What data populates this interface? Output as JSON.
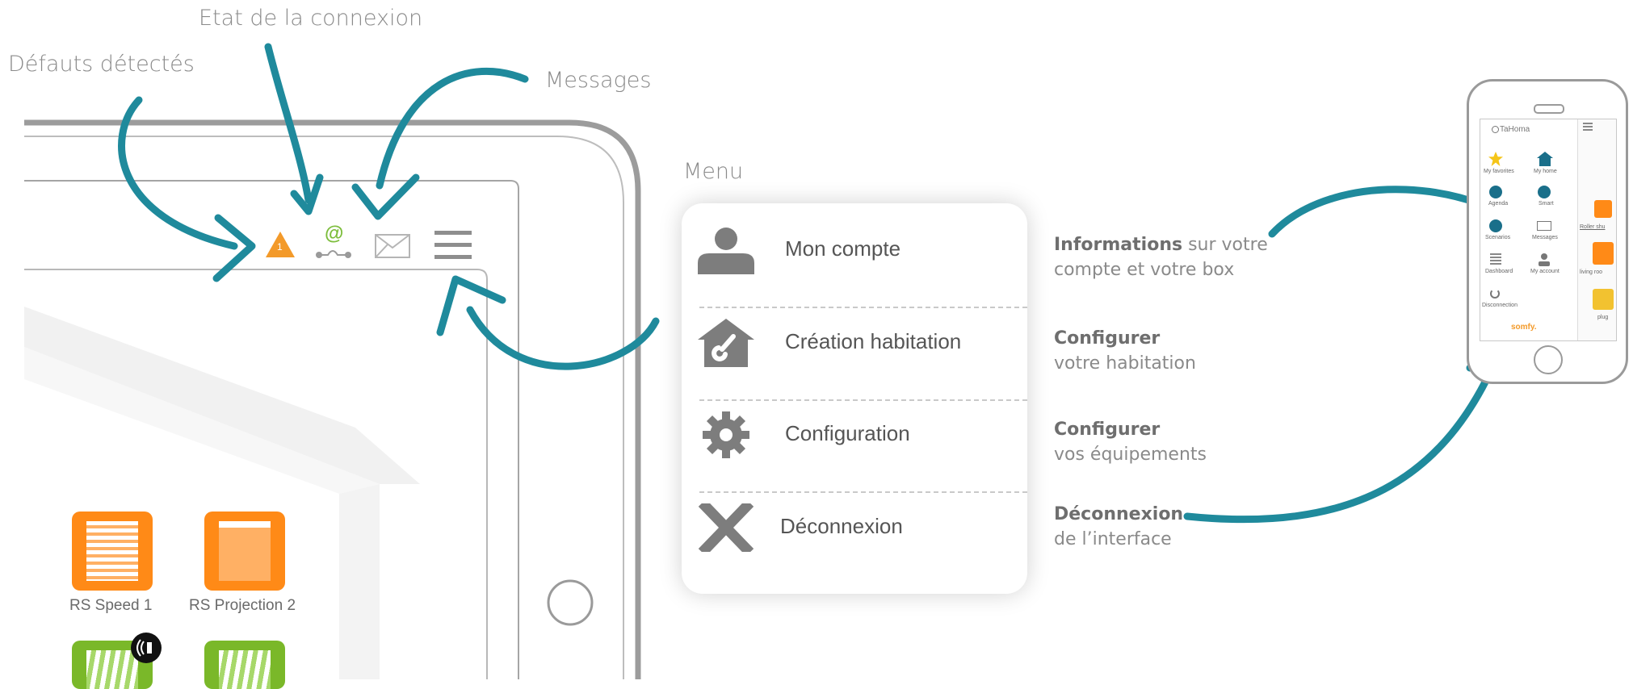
{
  "annotations": {
    "faults": "Défauts détectés",
    "connection": "Etat de la connexion",
    "messages": "Messages",
    "menu": "Menu"
  },
  "toolbar": {
    "alert_count": "1",
    "at_symbol": "@"
  },
  "menu": {
    "items": [
      {
        "label": "Mon compte"
      },
      {
        "label": "Création habitation"
      },
      {
        "label": "Configuration"
      },
      {
        "label": "Déconnexion"
      }
    ]
  },
  "descriptions": [
    {
      "bold": "Informations",
      "rest": " sur votre",
      "line2": "compte et votre box"
    },
    {
      "bold": "Configurer",
      "rest": "",
      "line2": "votre habitation"
    },
    {
      "bold": "Configurer",
      "rest": "",
      "line2": "vos équipements"
    },
    {
      "bold": "Déconnexion",
      "rest": "",
      "line2": "de l’interface"
    }
  ],
  "tiles": [
    {
      "label": "RS Speed 1"
    },
    {
      "label": "RS Projection 2"
    }
  ],
  "phone": {
    "app_name": "TaHoma",
    "menu": [
      "My favorites",
      "My home",
      "Agenda",
      "Smart",
      "Scenarios",
      "Messages",
      "Dashboard",
      "My account",
      "Disconnection"
    ],
    "side_labels": [
      "Roller shu",
      "living roo",
      "plug"
    ],
    "brand": "somfy."
  },
  "colors": {
    "arrow": "#1f8a9c",
    "alert": "#f39a2a",
    "connection": "#7cbd3b",
    "tile_orange": "#ff8a17",
    "tile_green": "#7ab829",
    "device_outline": "#a0a0a0"
  }
}
